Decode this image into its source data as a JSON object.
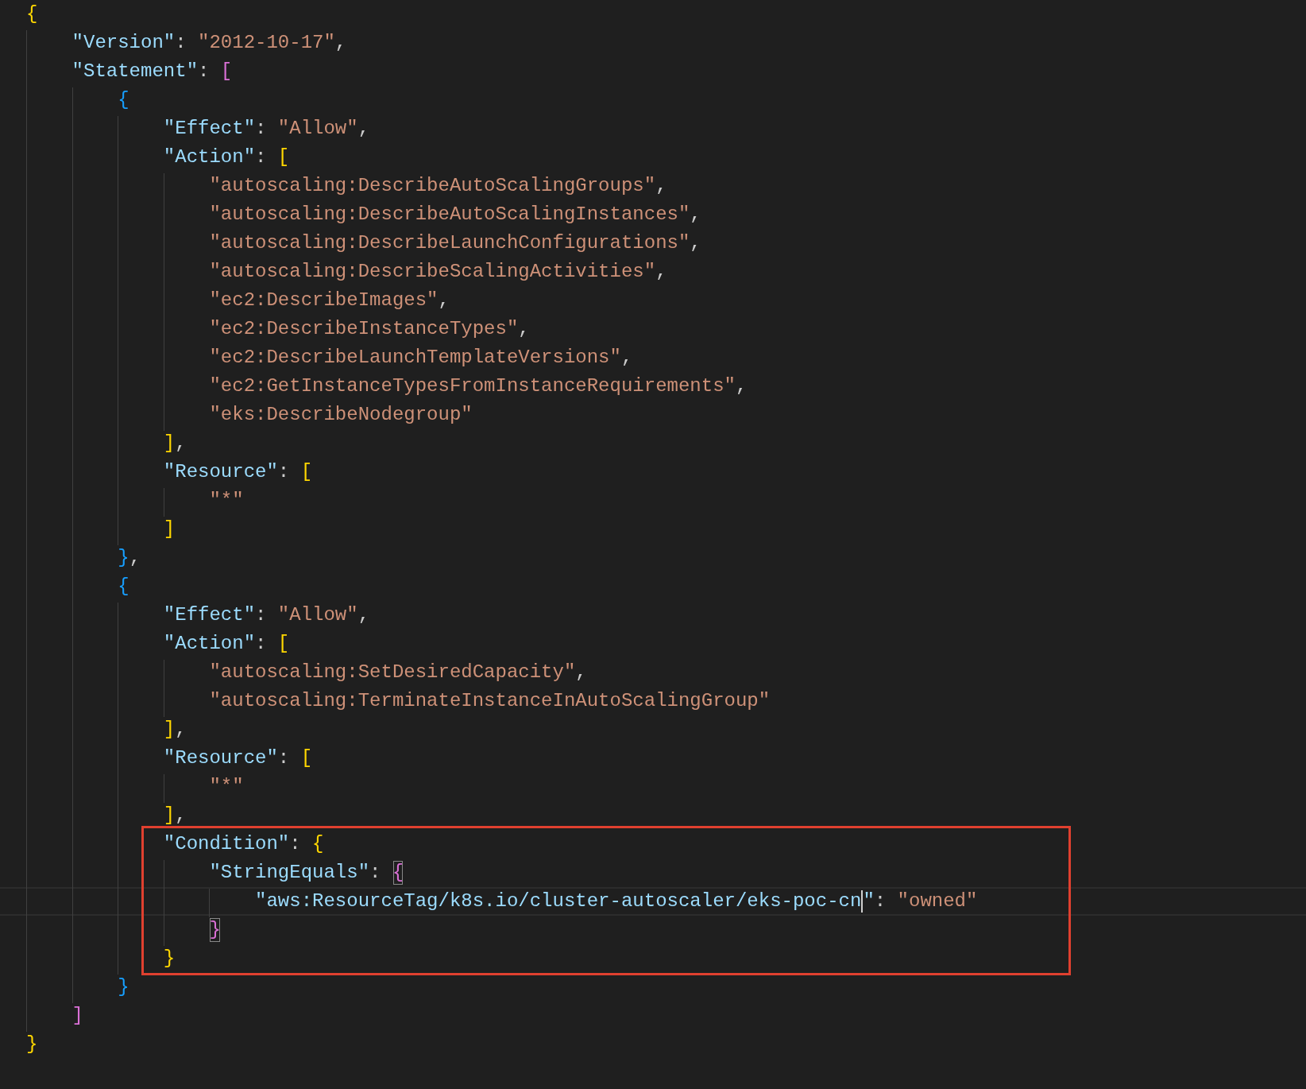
{
  "editor": {
    "blocks": [
      {
        "kind": "plain",
        "lines": [
          {
            "current": false,
            "tokens": [
              {
                "kind": "bracket",
                "text": "{",
                "matched": false
              }
            ]
          },
          {
            "current": false,
            "tokens": [
              {
                "kind": "key",
                "text": "\"Version\""
              },
              {
                "kind": "punct",
                "text": ":"
              },
              {
                "kind": "string",
                "text": "\"2012-10-17\""
              },
              {
                "kind": "punct",
                "text": ","
              }
            ]
          },
          {
            "current": false,
            "tokens": [
              {
                "kind": "key",
                "text": "\"Statement\""
              },
              {
                "kind": "punct",
                "text": ":"
              },
              {
                "kind": "bracket",
                "text": "[",
                "matched": false
              }
            ]
          },
          {
            "current": false,
            "tokens": [
              {
                "kind": "bracket",
                "text": "{",
                "matched": false
              }
            ]
          },
          {
            "current": false,
            "tokens": [
              {
                "kind": "key",
                "text": "\"Effect\""
              },
              {
                "kind": "punct",
                "text": ":"
              },
              {
                "kind": "string",
                "text": "\"Allow\""
              },
              {
                "kind": "punct",
                "text": ","
              }
            ]
          },
          {
            "current": false,
            "tokens": [
              {
                "kind": "key",
                "text": "\"Action\""
              },
              {
                "kind": "punct",
                "text": ":"
              },
              {
                "kind": "bracket",
                "text": "[",
                "matched": false
              }
            ]
          },
          {
            "current": false,
            "tokens": [
              {
                "kind": "string",
                "text": "\"autoscaling:DescribeAutoScalingGroups\""
              },
              {
                "kind": "punct",
                "text": ","
              }
            ]
          },
          {
            "current": false,
            "tokens": [
              {
                "kind": "string",
                "text": "\"autoscaling:DescribeAutoScalingInstances\""
              },
              {
                "kind": "punct",
                "text": ","
              }
            ]
          },
          {
            "current": false,
            "tokens": [
              {
                "kind": "string",
                "text": "\"autoscaling:DescribeLaunchConfigurations\""
              },
              {
                "kind": "punct",
                "text": ","
              }
            ]
          },
          {
            "current": false,
            "tokens": [
              {
                "kind": "string",
                "text": "\"autoscaling:DescribeScalingActivities\""
              },
              {
                "kind": "punct",
                "text": ","
              }
            ]
          },
          {
            "current": false,
            "tokens": [
              {
                "kind": "string",
                "text": "\"ec2:DescribeImages\""
              },
              {
                "kind": "punct",
                "text": ","
              }
            ]
          },
          {
            "current": false,
            "tokens": [
              {
                "kind": "string",
                "text": "\"ec2:DescribeInstanceTypes\""
              },
              {
                "kind": "punct",
                "text": ","
              }
            ]
          },
          {
            "current": false,
            "tokens": [
              {
                "kind": "string",
                "text": "\"ec2:DescribeLaunchTemplateVersions\""
              },
              {
                "kind": "punct",
                "text": ","
              }
            ]
          },
          {
            "current": false,
            "tokens": [
              {
                "kind": "string",
                "text": "\"ec2:GetInstanceTypesFromInstanceRequirements\""
              },
              {
                "kind": "punct",
                "text": ","
              }
            ]
          },
          {
            "current": false,
            "tokens": [
              {
                "kind": "string",
                "text": "\"eks:DescribeNodegroup\""
              }
            ]
          },
          {
            "current": false,
            "tokens": [
              {
                "kind": "bracket",
                "text": "]",
                "matched": false
              },
              {
                "kind": "punct",
                "text": ","
              }
            ]
          },
          {
            "current": false,
            "tokens": [
              {
                "kind": "key",
                "text": "\"Resource\""
              },
              {
                "kind": "punct",
                "text": ":"
              },
              {
                "kind": "bracket",
                "text": "[",
                "matched": false
              }
            ]
          },
          {
            "current": false,
            "tokens": [
              {
                "kind": "string",
                "text": "\"*\""
              }
            ]
          },
          {
            "current": false,
            "tokens": [
              {
                "kind": "bracket",
                "text": "]",
                "matched": false
              }
            ]
          },
          {
            "current": false,
            "tokens": [
              {
                "kind": "bracket",
                "text": "}",
                "matched": false
              },
              {
                "kind": "punct",
                "text": ","
              }
            ]
          },
          {
            "current": false,
            "tokens": [
              {
                "kind": "bracket",
                "text": "{",
                "matched": false
              }
            ]
          },
          {
            "current": false,
            "tokens": [
              {
                "kind": "key",
                "text": "\"Effect\""
              },
              {
                "kind": "punct",
                "text": ":"
              },
              {
                "kind": "string",
                "text": "\"Allow\""
              },
              {
                "kind": "punct",
                "text": ","
              }
            ]
          },
          {
            "current": false,
            "tokens": [
              {
                "kind": "key",
                "text": "\"Action\""
              },
              {
                "kind": "punct",
                "text": ":"
              },
              {
                "kind": "bracket",
                "text": "[",
                "matched": false
              }
            ]
          },
          {
            "current": false,
            "tokens": [
              {
                "kind": "string",
                "text": "\"autoscaling:SetDesiredCapacity\""
              },
              {
                "kind": "punct",
                "text": ","
              }
            ]
          },
          {
            "current": false,
            "tokens": [
              {
                "kind": "string",
                "text": "\"autoscaling:TerminateInstanceInAutoScalingGroup\""
              }
            ]
          },
          {
            "current": false,
            "tokens": [
              {
                "kind": "bracket",
                "text": "]",
                "matched": false
              },
              {
                "kind": "punct",
                "text": ","
              }
            ]
          },
          {
            "current": false,
            "tokens": [
              {
                "kind": "key",
                "text": "\"Resource\""
              },
              {
                "kind": "punct",
                "text": ":"
              },
              {
                "kind": "bracket",
                "text": "[",
                "matched": false
              }
            ]
          },
          {
            "current": false,
            "tokens": [
              {
                "kind": "string",
                "text": "\"*\""
              }
            ]
          },
          {
            "current": false,
            "tokens": [
              {
                "kind": "bracket",
                "text": "]",
                "matched": false
              },
              {
                "kind": "punct",
                "text": ","
              }
            ]
          }
        ]
      },
      {
        "kind": "highlight",
        "lines": [
          {
            "current": false,
            "tokens": [
              {
                "kind": "key",
                "text": "\"Condition\""
              },
              {
                "kind": "punct",
                "text": ":"
              },
              {
                "kind": "bracket",
                "text": "{",
                "matched": false
              }
            ]
          },
          {
            "current": false,
            "tokens": [
              {
                "kind": "key",
                "text": "\"StringEquals\""
              },
              {
                "kind": "punct",
                "text": ":"
              },
              {
                "kind": "bracket",
                "text": "{",
                "matched": true
              }
            ]
          },
          {
            "current": true,
            "tokens": [
              {
                "kind": "key",
                "text": "\"aws:ResourceTag/k8s.io/cluster-autoscaler/eks-poc-cn"
              },
              {
                "kind": "caret"
              },
              {
                "kind": "key",
                "text": "\""
              },
              {
                "kind": "punct",
                "text": ":"
              },
              {
                "kind": "string",
                "text": "\"owned\""
              }
            ]
          },
          {
            "current": false,
            "tokens": [
              {
                "kind": "bracket",
                "text": "}",
                "matched": true
              }
            ]
          },
          {
            "current": false,
            "tokens": [
              {
                "kind": "bracket",
                "text": "}",
                "matched": false
              }
            ]
          }
        ]
      },
      {
        "kind": "plain",
        "lines": [
          {
            "current": false,
            "tokens": [
              {
                "kind": "bracket",
                "text": "}",
                "matched": false
              }
            ]
          },
          {
            "current": false,
            "tokens": [
              {
                "kind": "bracket",
                "text": "]",
                "matched": false
              }
            ]
          },
          {
            "current": false,
            "tokens": [
              {
                "kind": "bracket",
                "text": "}",
                "matched": false
              }
            ]
          }
        ]
      }
    ]
  }
}
